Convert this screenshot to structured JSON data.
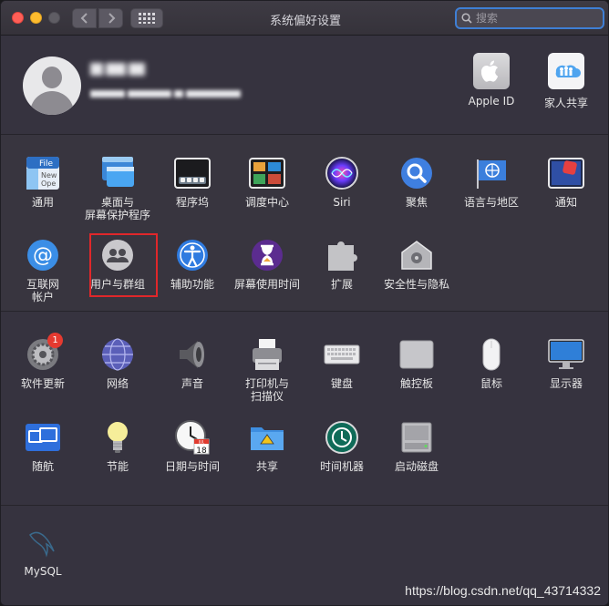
{
  "window": {
    "title": "系统偏好设置"
  },
  "search": {
    "placeholder": "搜索"
  },
  "account": {
    "apple_id": "Apple ID",
    "family": "家人共享"
  },
  "row1": [
    {
      "label": "通用",
      "icon": "general-icon"
    },
    {
      "label": "桌面与\n屏幕保护程序",
      "icon": "desktop-screensaver-icon"
    },
    {
      "label": "程序坞",
      "icon": "dock-icon"
    },
    {
      "label": "调度中心",
      "icon": "mission-control-icon"
    },
    {
      "label": "Siri",
      "icon": "siri-icon"
    },
    {
      "label": "聚焦",
      "icon": "spotlight-icon"
    },
    {
      "label": "语言与地区",
      "icon": "language-region-icon"
    },
    {
      "label": "通知",
      "icon": "notifications-icon"
    }
  ],
  "row2": [
    {
      "label": "互联网\n帐户",
      "icon": "internet-accounts-icon"
    },
    {
      "label": "用户与群组",
      "icon": "users-groups-icon"
    },
    {
      "label": "辅助功能",
      "icon": "accessibility-icon"
    },
    {
      "label": "屏幕使用时间",
      "icon": "screen-time-icon"
    },
    {
      "label": "扩展",
      "icon": "extensions-icon"
    },
    {
      "label": "安全性与隐私",
      "icon": "security-privacy-icon"
    }
  ],
  "row3": [
    {
      "label": "软件更新",
      "icon": "software-update-icon",
      "badge": "1"
    },
    {
      "label": "网络",
      "icon": "network-icon"
    },
    {
      "label": "声音",
      "icon": "sound-icon"
    },
    {
      "label": "打印机与\n扫描仪",
      "icon": "printers-scanners-icon"
    },
    {
      "label": "键盘",
      "icon": "keyboard-icon"
    },
    {
      "label": "触控板",
      "icon": "trackpad-icon"
    },
    {
      "label": "鼠标",
      "icon": "mouse-icon"
    },
    {
      "label": "显示器",
      "icon": "displays-icon"
    }
  ],
  "row4": [
    {
      "label": "随航",
      "icon": "sidecar-icon"
    },
    {
      "label": "节能",
      "icon": "energy-saver-icon"
    },
    {
      "label": "日期与时间",
      "icon": "date-time-icon",
      "calendar_month": "JUL",
      "calendar_day": "18"
    },
    {
      "label": "共享",
      "icon": "sharing-icon"
    },
    {
      "label": "时间机器",
      "icon": "time-machine-icon"
    },
    {
      "label": "启动磁盘",
      "icon": "startup-disk-icon"
    }
  ],
  "other": [
    {
      "label": "MySQL",
      "icon": "mysql-icon"
    }
  ],
  "watermark": "https://blog.csdn.net/qq_43714332"
}
